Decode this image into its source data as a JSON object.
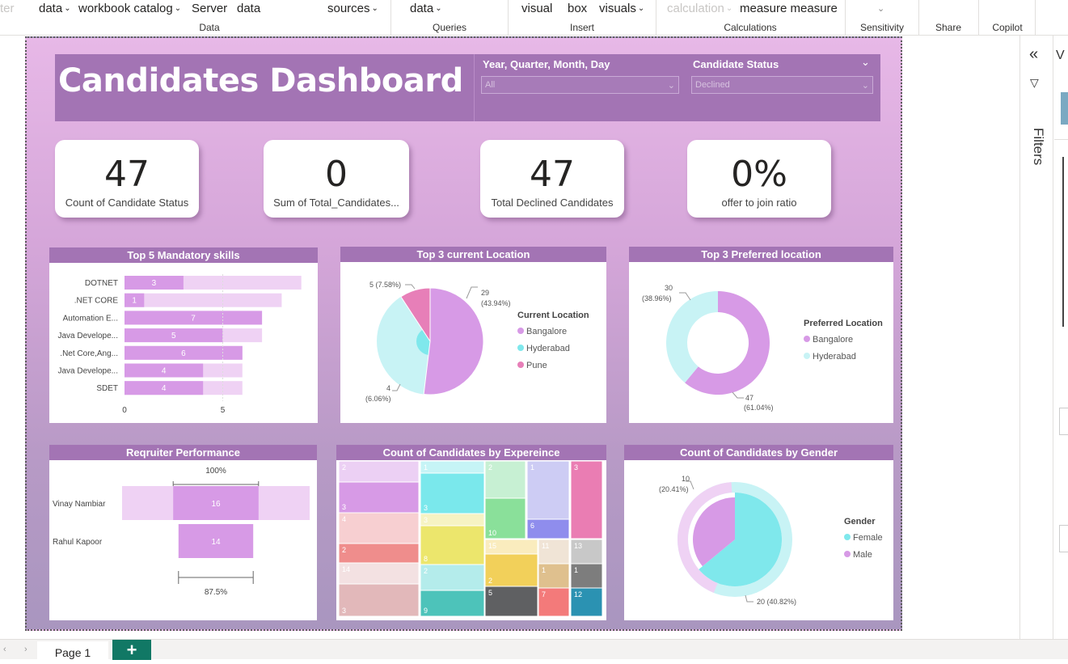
{
  "ribbon": {
    "items": [
      {
        "label": "ter",
        "disabled": true
      },
      {
        "label": "data",
        "chevron": true
      },
      {
        "label": "workbook catalog",
        "chevron": true
      },
      {
        "label": "Server"
      },
      {
        "label": "data"
      },
      {
        "label": "sources",
        "chevron": true
      },
      {
        "label": "data",
        "chevron": true
      },
      {
        "label": "visual"
      },
      {
        "label": "box"
      },
      {
        "label": "visuals",
        "chevron": true
      },
      {
        "label": "calculation",
        "chevron": true,
        "disabled": true
      },
      {
        "label": "measure measure"
      }
    ],
    "groups": [
      "Data",
      "Queries",
      "Insert",
      "Calculations",
      "Sensitivity",
      "Share",
      "Copilot"
    ]
  },
  "dashboard": {
    "title": "Candidates Dashboard",
    "slicers": [
      {
        "label": "Year, Quarter, Month, Day",
        "value": "All"
      },
      {
        "label": "Candidate Status",
        "value": "Declined"
      }
    ],
    "kpis": [
      {
        "value": "47",
        "label": "Count of Candidate Status"
      },
      {
        "value": "0",
        "label": "Sum of Total_Candidates..."
      },
      {
        "value": "47",
        "label": "Total Declined Candidates"
      },
      {
        "value": "0%",
        "label": "offer to join ratio"
      }
    ]
  },
  "chart_data": [
    {
      "type": "bar",
      "title": "Top 5 Mandatory skills",
      "categories": [
        "DOTNET",
        ".NET CORE",
        "Automation E...",
        "Java Develope...",
        ".Net Core,Ang...",
        "Java Develope...",
        "SDET"
      ],
      "values": [
        3,
        1,
        7,
        5,
        6,
        4,
        4
      ],
      "background_values": [
        9,
        8,
        7,
        7,
        6,
        6,
        6
      ],
      "xticks": [
        "0",
        "5"
      ],
      "colors": {
        "bar": "#d79ae6",
        "background": "#efd2f4"
      }
    },
    {
      "type": "pie",
      "title": "Top 3 current Location",
      "legend_title": "Current Location",
      "legend_position": "right",
      "slices": [
        {
          "label": "Bangalore",
          "value": 29,
          "pct_label": "29 (43.94%)",
          "color": "#d79ae6"
        },
        {
          "label": "Hyderabad",
          "value": 4,
          "pct_label": "4 (6.06%)",
          "color": "#7fe8ec"
        },
        {
          "label": "Pune",
          "value": 5,
          "pct_label": "5 (7.58%)",
          "color": "#e77fb8"
        }
      ]
    },
    {
      "type": "pie",
      "title": "Top 3 Preferred location",
      "legend_title": "Preferred Location",
      "legend_position": "right",
      "slices": [
        {
          "label": "Bangalore",
          "value": 47,
          "pct_label": "47 (61.04%)",
          "color": "#d79ae6"
        },
        {
          "label": "Hyderabad",
          "value": 30,
          "pct_label": "30 (38.96%)",
          "color": "#c8f3f5"
        }
      ]
    },
    {
      "type": "bar",
      "title": "Reqruiter Performance",
      "categories": [
        "Vinay Nambiar",
        "Rahul Kapoor"
      ],
      "values": [
        16,
        14
      ],
      "percent_labels": [
        "100%",
        "87.5%"
      ],
      "colors": {
        "bar": "#d79ae6",
        "background": "#efd2f4"
      }
    },
    {
      "type": "heatmap",
      "title": "Count of Candidates by Expereince",
      "values": [
        "2",
        "3",
        "4",
        "2",
        "14",
        "3",
        "1",
        "3",
        "3",
        "8",
        "2",
        "9",
        "2",
        "10",
        "1",
        "6",
        "3",
        "15",
        "2",
        "5",
        "11",
        "1",
        "7",
        "13",
        "1",
        "12"
      ]
    },
    {
      "type": "pie",
      "title": "Count of Candidates by Gender",
      "legend_title": "Gender",
      "legend_position": "right",
      "slices": [
        {
          "label": "Female",
          "value": 20,
          "pct_label": "20 (40.82%)",
          "color": "#7fe8ec"
        },
        {
          "label": "Male",
          "value": 10,
          "pct_label": "10 (20.41%)",
          "color": "#d79ae6"
        }
      ]
    }
  ],
  "right_pane": {
    "filters_label": "Filters"
  },
  "bottom": {
    "page_tab": "Page 1",
    "add_label": "+"
  }
}
